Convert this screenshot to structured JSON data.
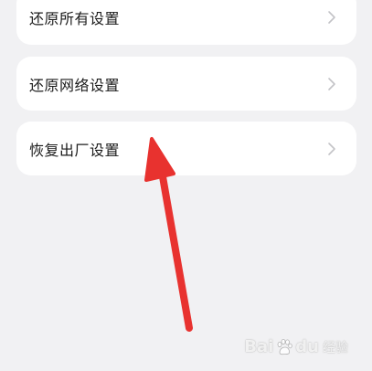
{
  "settings": {
    "items": [
      {
        "label": "还原所有设置"
      },
      {
        "label": "还原网络设置"
      },
      {
        "label": "恢复出厂设置"
      }
    ]
  },
  "annotation": {
    "arrow_color": "#e8322f",
    "points_to": "恢复出厂设置"
  },
  "watermark": {
    "brand_a": "Bai",
    "brand_b": "du",
    "suffix": "经验"
  },
  "colors": {
    "background": "#f1f1f3",
    "card": "#ffffff",
    "text": "#1b1b1b",
    "chevron": "#c3c3c7"
  },
  "icons": {
    "chevron": "chevron-right-icon",
    "logo": "baidu-paw-icon"
  }
}
